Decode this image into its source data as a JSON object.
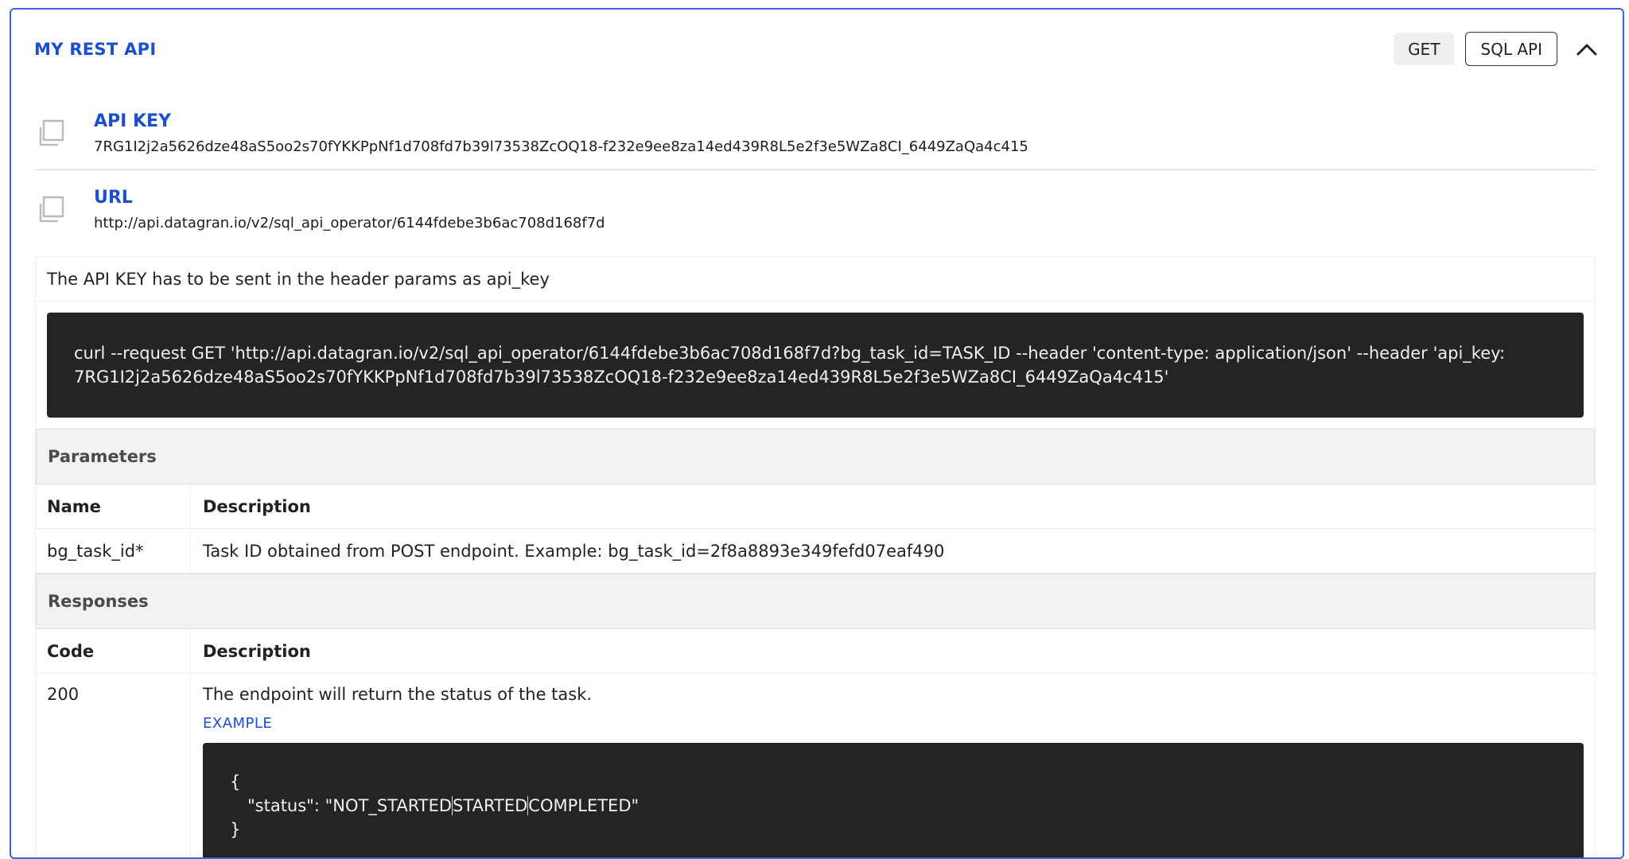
{
  "panel": {
    "title": "MY REST API",
    "method": "GET",
    "api_type": "SQL API"
  },
  "api_key": {
    "label": "API KEY",
    "value": "7RG1I2j2a5626dze48aS5oo2s70fYKKPpNf1d708fd7b39l73538ZcOQ18-f232e9ee8za14ed439R8L5e2f3e5WZa8CI_6449ZaQa4c415"
  },
  "url": {
    "label": "URL",
    "value": "http://api.datagran.io/v2/sql_api_operator/6144fdebe3b6ac708d168f7d"
  },
  "note": "The API KEY has to be sent in the header params as api_key",
  "curl": {
    "line1": "curl --request GET 'http://api.datagran.io/v2/sql_api_operator/6144fdebe3b6ac708d168f7d?bg_task_id=TASK_ID --header 'content-type: application/json' --header 'api_key:",
    "line2": "7RG1I2j2a5626dze48aS5oo2s70fYKKPpNf1d708fd7b39l73538ZcOQ18-f232e9ee8za14ed439R8L5e2f3e5WZa8CI_6449ZaQa4c415'"
  },
  "parameters": {
    "title": "Parameters",
    "headers": [
      "Name",
      "Description"
    ],
    "rows": [
      {
        "name": "bg_task_id*",
        "description": "Task ID obtained from POST endpoint. Example: bg_task_id=2f8a8893e349fefd07eaf490"
      }
    ]
  },
  "responses": {
    "title": "Responses",
    "headers": [
      "Code",
      "Description"
    ],
    "rows": [
      {
        "code": "200",
        "description": "The endpoint will return the status of the task.",
        "example_label": "EXAMPLE",
        "example": {
          "open": "{",
          "line_key": "\"status\": \"NOT_STARTED",
          "line_mid": "STARTED",
          "line_end": "COMPLETED\"",
          "close": "}"
        }
      }
    ]
  }
}
